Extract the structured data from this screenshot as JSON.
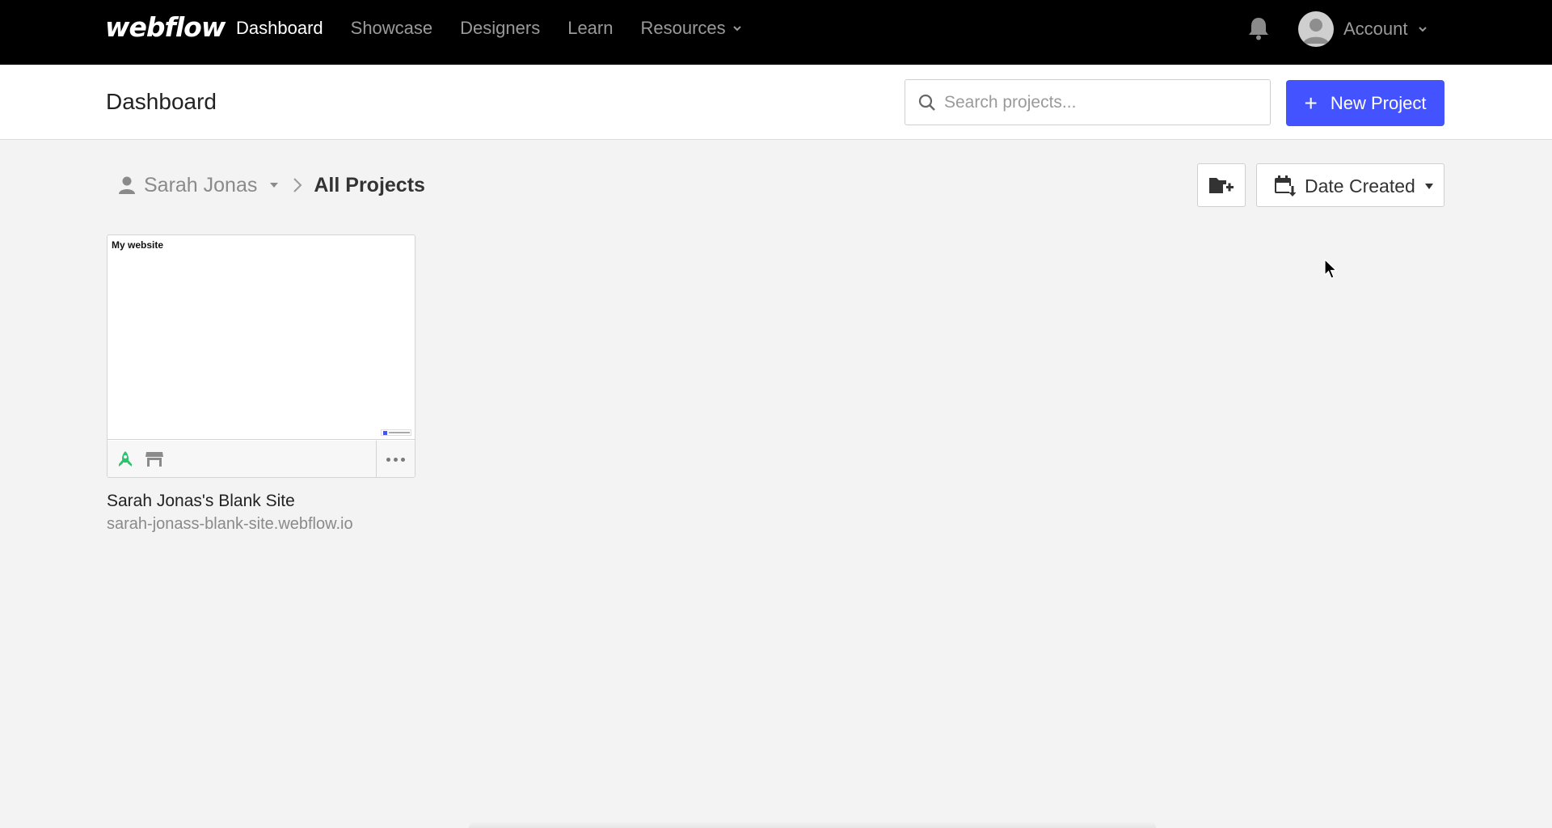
{
  "nav": {
    "logo": "webflow",
    "links": [
      "Dashboard",
      "Showcase",
      "Designers",
      "Learn",
      "Resources"
    ],
    "account_label": "Account"
  },
  "subheader": {
    "title": "Dashboard",
    "search_placeholder": "Search projects...",
    "new_project_label": "New Project"
  },
  "breadcrumb": {
    "user": "Sarah Jonas",
    "current": "All Projects"
  },
  "sort": {
    "selected": "Date Created"
  },
  "project": {
    "thumb_title": "My website",
    "name": "Sarah Jonas's Blank Site",
    "url": "sarah-jonass-blank-site.webflow.io"
  },
  "colors": {
    "accent": "#4353ff",
    "published_green": "#2bc46e"
  },
  "icons": [
    "bell-icon",
    "avatar-icon",
    "search-icon",
    "user-icon",
    "chevron-right-icon",
    "folder-add-icon",
    "calendar-sort-icon",
    "rocket-icon",
    "store-icon",
    "more-icon"
  ]
}
